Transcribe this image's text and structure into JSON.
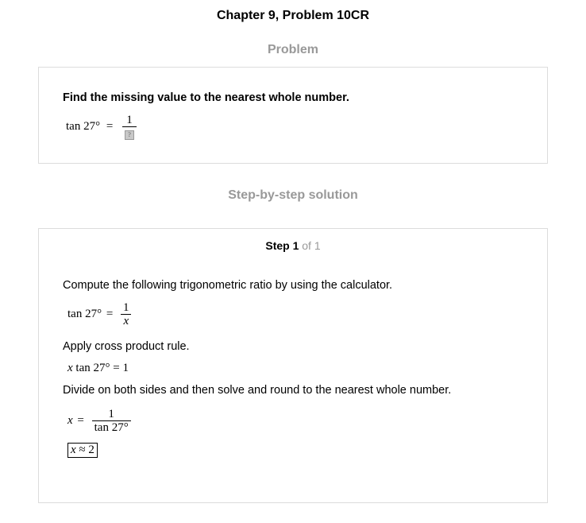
{
  "header": {
    "title": "Chapter 9, Problem 10CR"
  },
  "problem": {
    "heading": "Problem",
    "instruction": "Find the missing value to the nearest whole number.",
    "equation": {
      "lhs": "tan 27°",
      "eq": "=",
      "numerator": "1",
      "missing": "?"
    }
  },
  "solution": {
    "heading": "Step-by-step solution",
    "step": {
      "label": "Step 1",
      "of": "of 1"
    },
    "paragraphs": [
      "Compute the following trigonometric ratio by using the calculator.",
      "Apply cross product rule.",
      "Divide on both sides and then solve and round to the nearest whole number."
    ],
    "eq1": {
      "lhs": "tan 27°",
      "eq": "=",
      "numerator": "1",
      "denominator": "x"
    },
    "eq2": {
      "var": "x",
      "rest": "tan 27°",
      "eq": "=",
      "rhs": "1"
    },
    "eq3": {
      "var": "x",
      "eq": "=",
      "numerator": "1",
      "denominator": "tan 27°"
    },
    "answer": {
      "var": "x",
      "approx": "≈",
      "value": "2"
    }
  }
}
